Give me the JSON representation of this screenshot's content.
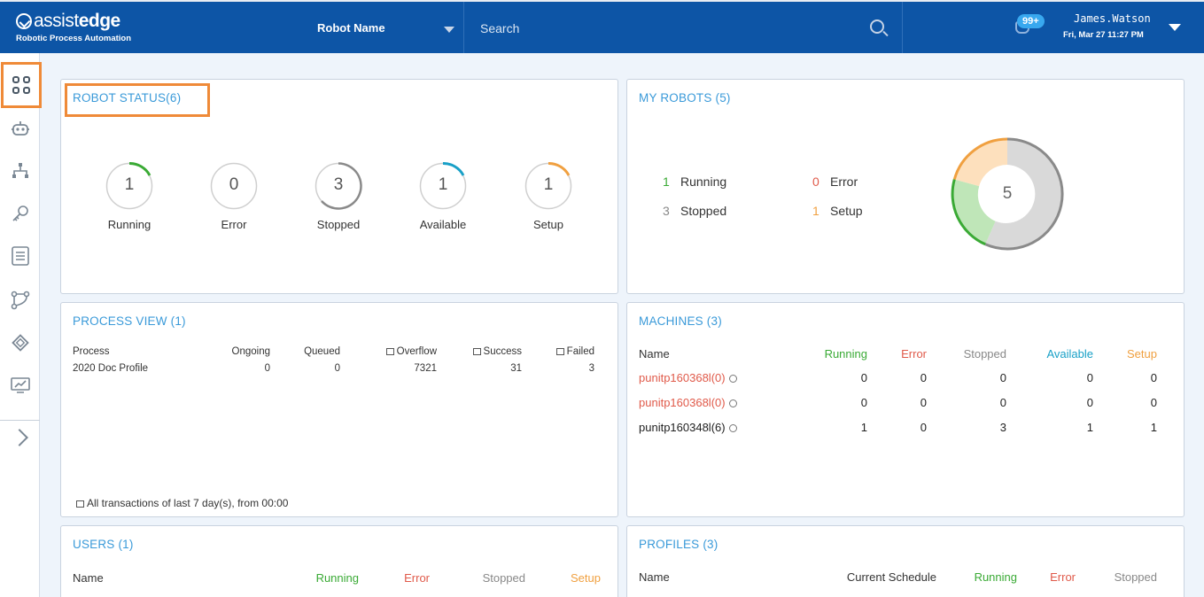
{
  "header": {
    "logo_text_assist": "assist",
    "logo_text_edge": "edge",
    "logo_sub": "Robotic Process Automation",
    "robot_select": "Robot Name",
    "search_placeholder": "Search",
    "notif_badge": "99+",
    "user_name": "James.Watson",
    "user_datetime": "Fri, Mar 27 11:27 PM"
  },
  "colors": {
    "header_bg": "#0d55a6",
    "accent": "#3a9ad9",
    "running": "#3aaa35",
    "error": "#e05a4a",
    "stopped": "#888888",
    "available": "#19a0c7",
    "setup": "#f0a040",
    "highlight": "#ef8a38"
  },
  "sidebar": {
    "icons": [
      "dashboard-icon",
      "robot-icon",
      "hierarchy-icon",
      "key-icon",
      "list-icon",
      "workflow-icon",
      "chip-icon",
      "monitor-chart-icon",
      "expand-chevron-icon"
    ]
  },
  "robot_status": {
    "title": "ROBOT STATUS(6)",
    "items": [
      {
        "label": "Running",
        "value": "1"
      },
      {
        "label": "Error",
        "value": "0"
      },
      {
        "label": "Stopped",
        "value": "3"
      },
      {
        "label": "Available",
        "value": "1"
      },
      {
        "label": "Setup",
        "value": "1"
      }
    ]
  },
  "my_robots": {
    "title": "MY ROBOTS (5)",
    "total": "5",
    "running": {
      "value": "1",
      "label": "Running"
    },
    "error": {
      "value": "0",
      "label": "Error"
    },
    "stopped": {
      "value": "3",
      "label": "Stopped"
    },
    "setup": {
      "value": "1",
      "label": "Setup"
    }
  },
  "process_view": {
    "title": "PROCESS VIEW (1)",
    "headers": [
      "Process",
      "Ongoing",
      "Queued",
      "Overflow",
      "Success",
      "Failed"
    ],
    "rows": [
      [
        "2020 Doc Profile",
        "0",
        "0",
        "7321",
        "31",
        "3"
      ]
    ],
    "footer": "All transactions of last 7 day(s), from 00:00"
  },
  "machines": {
    "title": "MACHINES (3)",
    "headers": [
      "Name",
      "Running",
      "Error",
      "Stopped",
      "Available",
      "Setup"
    ],
    "rows": [
      [
        "punitp160368l(0)",
        "0",
        "0",
        "0",
        "0",
        "0"
      ],
      [
        "punitp160368l(0)",
        "0",
        "0",
        "0",
        "0",
        "0"
      ],
      [
        "punitp160348l(6)",
        "1",
        "0",
        "3",
        "1",
        "1"
      ]
    ]
  },
  "users": {
    "title": "USERS (1)",
    "headers": [
      "Name",
      "Running",
      "Error",
      "Stopped",
      "Setup"
    ]
  },
  "profiles": {
    "title": "PROFILES (3)",
    "headers": [
      "Name",
      "Current Schedule",
      "Running",
      "Error",
      "Stopped"
    ]
  }
}
